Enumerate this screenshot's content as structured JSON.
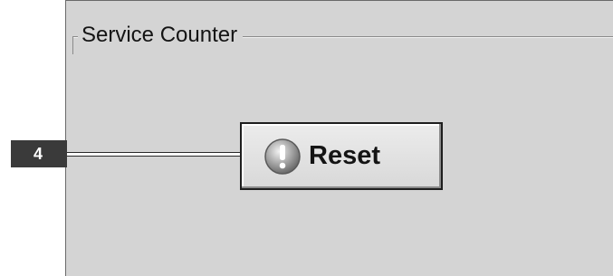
{
  "group": {
    "title": "Service Counter"
  },
  "callout": {
    "number": "4"
  },
  "reset_button": {
    "label": "Reset",
    "icon": "warning-exclamation-icon"
  }
}
